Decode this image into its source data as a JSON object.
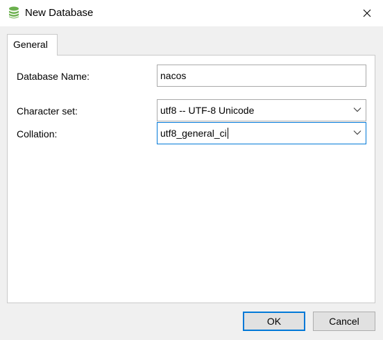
{
  "window": {
    "title": "New Database"
  },
  "tabs": [
    {
      "label": "General"
    }
  ],
  "form": {
    "database_name": {
      "label": "Database Name:",
      "value": "nacos"
    },
    "character_set": {
      "label": "Character set:",
      "value": "utf8 -- UTF-8 Unicode"
    },
    "collation": {
      "label": "Collation:",
      "value": "utf8_general_ci"
    }
  },
  "buttons": {
    "ok": "OK",
    "cancel": "Cancel"
  },
  "colors": {
    "accent": "#0078d7",
    "icon_green": "#6bb04e"
  },
  "icons": {
    "app": "database-icon",
    "close": "close-icon",
    "dropdown": "chevron-down-icon"
  }
}
